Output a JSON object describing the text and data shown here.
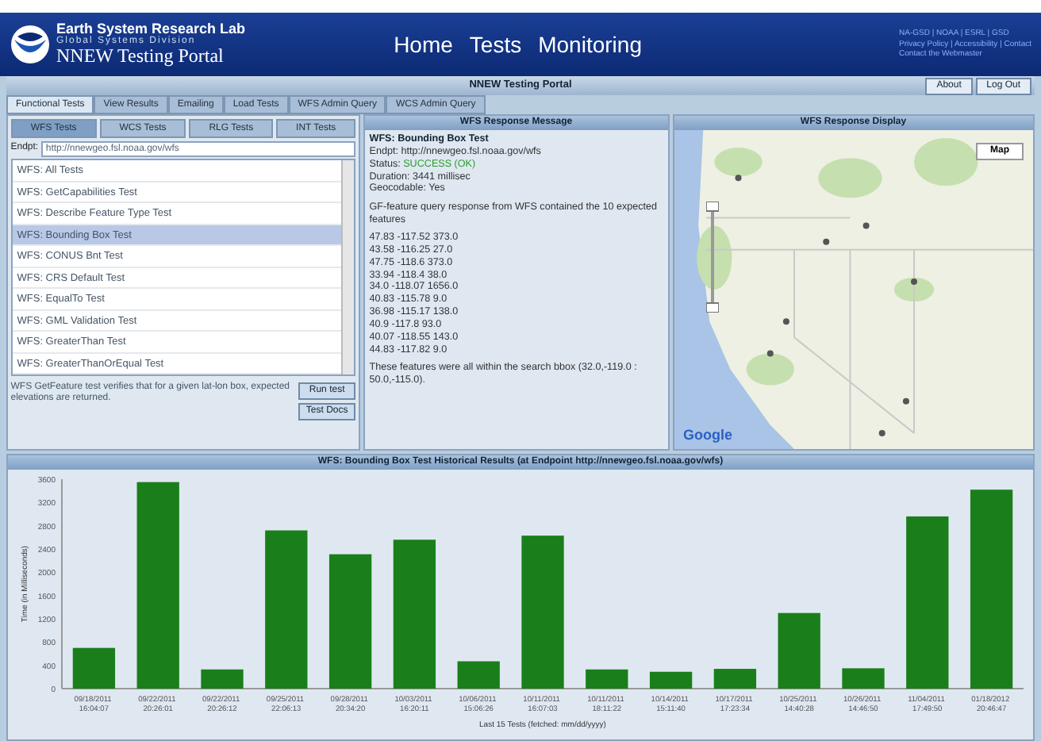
{
  "header": {
    "org": "Earth System Research Lab",
    "division": "Global Systems Division",
    "portal": "NNEW Testing Portal",
    "nav": [
      "Home",
      "Tests",
      "Monitoring"
    ],
    "links": [
      "NA-GSD | NOAA | ESRL | GSD",
      "Privacy Policy | Accessibility | Contact",
      "Contact the Webmaster"
    ]
  },
  "titlebar": {
    "title": "NNEW Testing Portal",
    "buttons": [
      "About",
      "Log Out"
    ]
  },
  "tabs": [
    {
      "label": "Functional Tests",
      "selected": true
    },
    {
      "label": "View Results",
      "selected": false
    },
    {
      "label": "Emailing",
      "selected": false
    },
    {
      "label": "Load Tests",
      "selected": false
    },
    {
      "label": "WFS Admin Query",
      "selected": false
    },
    {
      "label": "WCS Admin Query",
      "selected": false
    }
  ],
  "test_panel": {
    "subtabs": [
      {
        "label": "WFS Tests",
        "selected": true
      },
      {
        "label": "WCS Tests",
        "selected": false
      },
      {
        "label": "RLG Tests",
        "selected": false
      },
      {
        "label": "INT Tests",
        "selected": false
      }
    ],
    "endpoint_label": "Endpt:",
    "endpoint": "http://nnewgeo.fsl.noaa.gov/wfs",
    "tests": [
      {
        "label": "WFS: All Tests",
        "selected": false
      },
      {
        "label": "WFS: GetCapabilities Test",
        "selected": false
      },
      {
        "label": "WFS: Describe Feature Type Test",
        "selected": false
      },
      {
        "label": "WFS: Bounding Box Test",
        "selected": true
      },
      {
        "label": "WFS: CONUS Bnt Test",
        "selected": false
      },
      {
        "label": "WFS: CRS Default Test",
        "selected": false
      },
      {
        "label": "WFS: EqualTo Test",
        "selected": false
      },
      {
        "label": "WFS: GML Validation Test",
        "selected": false
      },
      {
        "label": "WFS: GreaterThan Test",
        "selected": false
      },
      {
        "label": "WFS: GreaterThanOrEqual Test",
        "selected": false
      }
    ],
    "description": "WFS GetFeature test verifies that for a given lat-lon box, expected elevations are returned.",
    "buttons": [
      "Run test",
      "Test Docs"
    ]
  },
  "message_panel": {
    "title": "WFS Response Message",
    "test_name": "WFS: Bounding Box Test",
    "endpoint": "Endpt: http://nnewgeo.fsl.noaa.gov/wfs",
    "status_label": "Status:",
    "status": "SUCCESS (OK)",
    "duration": "Duration: 3441 millisec",
    "geocodable": "Geocodable: Yes",
    "summary": "GF-feature query response from WFS contained the 10 expected features",
    "features": [
      "47.83 -117.52 373.0",
      "43.58 -116.25 27.0",
      "47.75 -118.6 373.0",
      "33.94 -118.4 38.0",
      "34.0 -118.07 1656.0",
      "40.83 -115.78 9.0",
      "36.98 -115.17 138.0",
      "40.9 -117.8 93.0",
      "40.07 -118.55 143.0",
      "44.83 -117.82 9.0"
    ],
    "conclusion": "These features were all within the search bbox (32.0,-119.0 : 50.0,-115.0)."
  },
  "map_panel": {
    "title": "WFS Response Display",
    "map_button": "Map",
    "logo": "Google"
  },
  "history": {
    "title": "WFS: Bounding Box Test Historical Results (at Endpoint http://nnewgeo.fsl.noaa.gov/wfs)",
    "chart_data": {
      "type": "bar",
      "xlabel": "Last 15 Tests (fetched: mm/dd/yyyy)",
      "ylabel": "Time (in Milliseconds)",
      "categories": [
        "09/18/2011 16:04:07",
        "09/22/2011 20:26:01",
        "09/22/2011 20:26:12",
        "09/25/2011 22:06:13",
        "09/28/2011 20:34:20",
        "10/03/2011 16:20:11",
        "10/06/2011 15:06:26",
        "10/11/2011 16:07:03",
        "10/11/2011 18:11:22",
        "10/14/2011 15:11:40",
        "10/17/2011 17:23:34",
        "10/25/2011 14:40:28",
        "10/26/2011 14:46:50",
        "11/04/2011 17:49:50",
        "01/18/2012 20:46:47"
      ],
      "series": [
        {
          "color": "#1a7f1a",
          "values": [
            700,
            3550,
            330,
            2720,
            2310,
            2560,
            470,
            2630,
            330,
            290,
            340,
            1300,
            350,
            2960,
            3420
          ]
        }
      ],
      "ylim": [
        0,
        3600
      ],
      "yticks": [
        0,
        400,
        800,
        1200,
        1600,
        2000,
        2400,
        2800,
        3200,
        3600
      ]
    }
  }
}
